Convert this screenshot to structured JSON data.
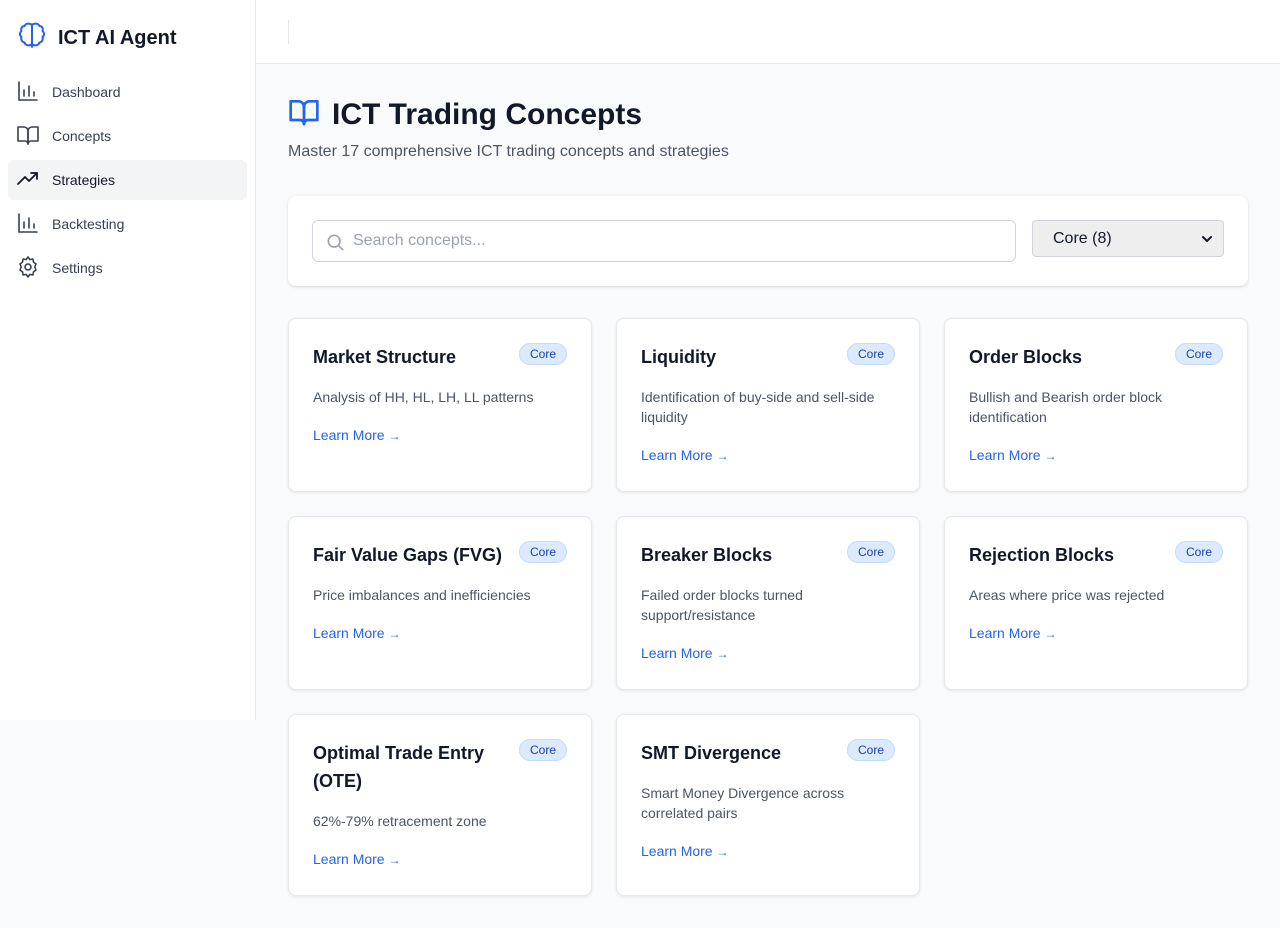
{
  "app": {
    "title": "ICT AI Agent"
  },
  "sidebar": {
    "items": [
      {
        "label": "Dashboard",
        "icon": "bar-chart-icon"
      },
      {
        "label": "Concepts",
        "icon": "book-icon"
      },
      {
        "label": "Strategies",
        "icon": "trending-up-icon",
        "active": true
      },
      {
        "label": "Backtesting",
        "icon": "bar-chart-icon"
      },
      {
        "label": "Settings",
        "icon": "gear-icon"
      }
    ]
  },
  "page": {
    "title": "ICT Trading Concepts",
    "subtitle": "Master 17 comprehensive ICT trading concepts and strategies"
  },
  "search": {
    "placeholder": "Search concepts...",
    "value": ""
  },
  "filter": {
    "selected": "Core (8)"
  },
  "colors": {
    "accent": "#2563eb",
    "badge_bg": "#dbeafe",
    "badge_text": "#1e40af"
  },
  "cards": [
    {
      "title": "Market Structure",
      "badge": "Core",
      "description": "Analysis of HH, HL, LH, LL patterns",
      "link": "Learn More",
      "arrow": "→"
    },
    {
      "title": "Liquidity",
      "badge": "Core",
      "description": "Identification of buy-side and sell-side liquidity",
      "link": "Learn More",
      "arrow": "→"
    },
    {
      "title": "Order Blocks",
      "badge": "Core",
      "description": "Bullish and Bearish order block identification",
      "link": "Learn More",
      "arrow": "→"
    },
    {
      "title": "Fair Value Gaps (FVG)",
      "badge": "Core",
      "description": "Price imbalances and inefficiencies",
      "link": "Learn More",
      "arrow": "→"
    },
    {
      "title": "Breaker Blocks",
      "badge": "Core",
      "description": "Failed order blocks turned support/resistance",
      "link": "Learn More",
      "arrow": "→"
    },
    {
      "title": "Rejection Blocks",
      "badge": "Core",
      "description": "Areas where price was rejected",
      "link": "Learn More",
      "arrow": "→"
    },
    {
      "title": "Optimal Trade Entry (OTE)",
      "badge": "Core",
      "description": "62%-79% retracement zone",
      "link": "Learn More",
      "arrow": "→"
    },
    {
      "title": "SMT Divergence",
      "badge": "Core",
      "description": "Smart Money Divergence across correlated pairs",
      "link": "Learn More",
      "arrow": "→"
    }
  ]
}
